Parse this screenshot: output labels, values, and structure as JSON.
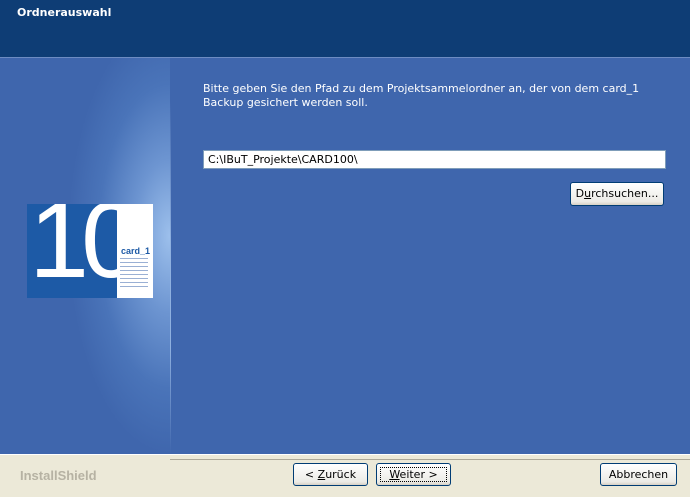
{
  "window": {
    "title": "Ordnerauswahl"
  },
  "instruction": "Bitte geben Sie den Pfad zu dem Projektsammelordner an, der von dem card_1 Backup gesichert werden soll.",
  "path_field": {
    "value": "C:\\IBuT_Projekte\\CARD100\\"
  },
  "browse_button": {
    "pre": "D",
    "mnemonic": "u",
    "post": "rchsuchen..."
  },
  "logo": {
    "number": "10",
    "brand": "card_1"
  },
  "footer": {
    "brand": "InstallShield",
    "back": {
      "pre": "< ",
      "mnemonic": "Z",
      "post": "urück"
    },
    "next": {
      "pre": "",
      "mnemonic": "W",
      "post": "eiter >"
    },
    "cancel": "Abbrechen"
  }
}
